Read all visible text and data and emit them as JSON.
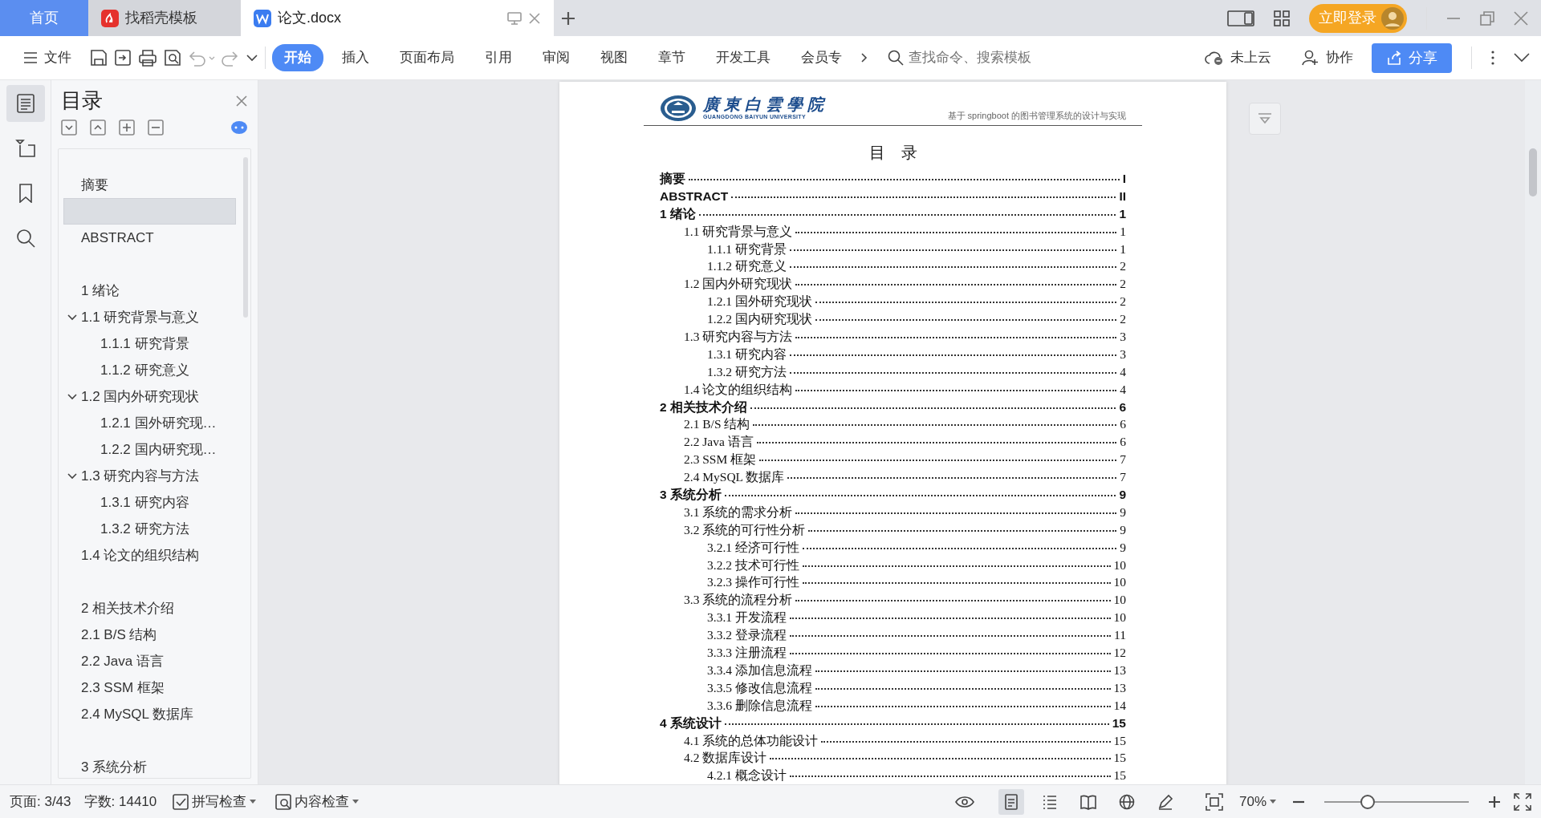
{
  "tabs": [
    {
      "label": "首页",
      "kind": "home",
      "selected": false
    },
    {
      "label": "找稻壳模板",
      "kind": "docer",
      "selected": false
    },
    {
      "label": "论文.docx",
      "kind": "document",
      "selected": true
    }
  ],
  "account": {
    "login": "立即登录"
  },
  "menu": {
    "label": "文件"
  },
  "ribbon_tabs": [
    {
      "label": "开始",
      "selected": true
    },
    {
      "label": "插入",
      "selected": false
    },
    {
      "label": "页面布局",
      "selected": false
    },
    {
      "label": "引用",
      "selected": false
    },
    {
      "label": "审阅",
      "selected": false
    },
    {
      "label": "视图",
      "selected": false
    },
    {
      "label": "章节",
      "selected": false
    },
    {
      "label": "开发工具",
      "selected": false
    },
    {
      "label": "会员专",
      "selected": false
    }
  ],
  "search": {
    "placeholder": "查找命令、搜索模板"
  },
  "cloud": "未上云",
  "collab": "协作",
  "share": "分享",
  "sidebar": {
    "title": "目录",
    "items": [
      {
        "label": "摘要",
        "selected": false
      },
      {
        "selected": true
      },
      {
        "label": "ABSTRACT",
        "selected": false
      },
      {
        "selected": false
      },
      {
        "label": "1 绪论",
        "selected": false
      },
      {
        "label": "1.1 研究背景与意义",
        "selected": false,
        "expanded": true,
        "children": [
          {
            "label": "1.1.1 研究背景",
            "selected": false
          },
          {
            "label": "1.1.2 研究意义",
            "selected": false
          }
        ]
      },
      {
        "label": "1.2 国内外研究现状",
        "selected": false,
        "expanded": true,
        "children": [
          {
            "label": "1.2.1 国外研究现…",
            "selected": false
          },
          {
            "label": "1.2.2 国内研究现…",
            "selected": false
          }
        ]
      },
      {
        "label": "1.3 研究内容与方法",
        "selected": false,
        "expanded": true,
        "children": [
          {
            "label": "1.3.1 研究内容",
            "selected": false
          },
          {
            "label": "1.3.2 研究方法",
            "selected": false
          }
        ]
      },
      {
        "label": "1.4 论文的组织结构",
        "selected": false
      },
      {
        "selected": false
      },
      {
        "label": "2 相关技术介绍",
        "selected": false
      },
      {
        "label": "2.1 B/S 结构",
        "selected": false
      },
      {
        "label": "2.2 Java 语言",
        "selected": false
      },
      {
        "label": "2.3 SSM 框架",
        "selected": false
      },
      {
        "label": "2.4 MySQL 数据库",
        "selected": false
      },
      {
        "selected": false
      },
      {
        "label": "3 系统分析",
        "selected": false
      }
    ]
  },
  "document": {
    "school_name": "廣東白雲學院",
    "school_name_en": "GUANGDONG BAIYUN UNIVERSITY",
    "header_title": "基于 springboot 的图书管理系统的设计与实现",
    "toc_title": "目　录",
    "toc": [
      {
        "text": "摘要",
        "page": "I"
      },
      {
        "text": "ABSTRACT",
        "page": "II"
      },
      {
        "text": "1 绪论",
        "page": "1",
        "children": [
          {
            "text": "1.1 研究背景与意义",
            "page": "1",
            "children": [
              {
                "text": "1.1.1 研究背景",
                "page": "1"
              },
              {
                "text": "1.1.2 研究意义",
                "page": "2"
              }
            ]
          },
          {
            "text": "1.2 国内外研究现状",
            "page": "2",
            "children": [
              {
                "text": "1.2.1 国外研究现状",
                "page": "2"
              },
              {
                "text": "1.2.2 国内研究现状",
                "page": "2"
              }
            ]
          },
          {
            "text": "1.3 研究内容与方法",
            "page": "3",
            "children": [
              {
                "text": "1.3.1 研究内容",
                "page": "3"
              },
              {
                "text": "1.3.2 研究方法",
                "page": "4"
              }
            ]
          },
          {
            "text": "1.4 论文的组织结构",
            "page": "4"
          }
        ]
      },
      {
        "text": "2 相关技术介绍",
        "page": "6",
        "children": [
          {
            "text": "2.1 B/S 结构",
            "page": "6"
          },
          {
            "text": "2.2 Java 语言",
            "page": "6"
          },
          {
            "text": "2.3 SSM 框架",
            "page": "7"
          },
          {
            "text": "2.4 MySQL 数据库",
            "page": "7"
          }
        ]
      },
      {
        "text": "3 系统分析",
        "page": "9",
        "children": [
          {
            "text": "3.1 系统的需求分析",
            "page": "9"
          },
          {
            "text": "3.2 系统的可行性分析",
            "page": "9",
            "children": [
              {
                "text": "3.2.1 经济可行性",
                "page": "9"
              },
              {
                "text": "3.2.2 技术可行性",
                "page": "10"
              },
              {
                "text": "3.2.3 操作可行性",
                "page": "10"
              }
            ]
          },
          {
            "text": "3.3 系统的流程分析",
            "page": "10",
            "children": [
              {
                "text": "3.3.1 开发流程",
                "page": "10"
              },
              {
                "text": "3.3.2 登录流程",
                "page": "11"
              },
              {
                "text": "3.3.3 注册流程",
                "page": "12"
              },
              {
                "text": "3.3.4 添加信息流程",
                "page": "13"
              },
              {
                "text": "3.3.5 修改信息流程",
                "page": "13"
              },
              {
                "text": "3.3.6 删除信息流程",
                "page": "14"
              }
            ]
          }
        ]
      },
      {
        "text": "4 系统设计",
        "page": "15",
        "children": [
          {
            "text": "4.1 系统的总体功能设计",
            "page": "15"
          },
          {
            "text": "4.2 数据库设计",
            "page": "15",
            "children": [
              {
                "text": "4.2.1 概念设计",
                "page": "15"
              }
            ]
          }
        ]
      }
    ]
  },
  "status_bar": {
    "page": "页面: 3/43",
    "words": "字数: 14410",
    "spell_check": "拼写检查",
    "content_check": "内容检查",
    "view_modes": [
      {
        "kind": "page",
        "selected": true
      },
      {
        "kind": "outline",
        "selected": false
      },
      {
        "kind": "reading",
        "selected": false
      },
      {
        "kind": "web",
        "selected": false
      },
      {
        "kind": "pen",
        "selected": false
      }
    ],
    "zoom": "70%",
    "zoom_slider": {
      "level": 0.3
    }
  }
}
